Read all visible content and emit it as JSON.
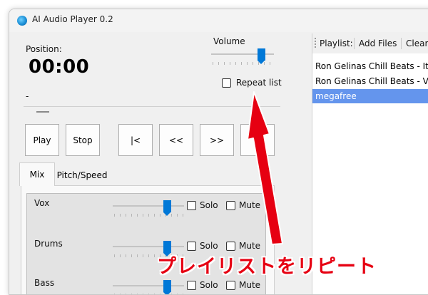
{
  "window": {
    "title": "AI Audio Player 0.2"
  },
  "position": {
    "label": "Position:",
    "value": "00:00",
    "sub_value": "-"
  },
  "volume": {
    "label": "Volume",
    "level_fraction": 0.85
  },
  "repeat": {
    "label": "Repeat list",
    "checked": false
  },
  "transport": {
    "play": "Play",
    "stop": "Stop",
    "prev": "|<",
    "rewind": "<<",
    "forward": ">>",
    "next": ">|"
  },
  "tabs": [
    {
      "label": "Mix",
      "active": true
    },
    {
      "label": "Pitch/Speed",
      "active": false
    }
  ],
  "mix": {
    "solo_label": "Solo",
    "mute_label": "Mute",
    "tracks": [
      {
        "name": "Vox",
        "level_fraction": 0.8
      },
      {
        "name": "Drums",
        "level_fraction": 0.8
      },
      {
        "name": "Bass",
        "level_fraction": 0.8
      }
    ]
  },
  "playlist": {
    "toolbar_label": "Playlist:",
    "add_files": "Add Files",
    "clear": "Clear",
    "items": [
      {
        "text": "Ron Gelinas Chill Beats - It's Jus",
        "selected": false
      },
      {
        "text": "Ron Gelinas Chill Beats - Vibe",
        "selected": false
      },
      {
        "text": "megafree",
        "selected": true
      }
    ]
  },
  "annotation": {
    "caption": "プレイリストをリピート",
    "arrow_color": "#e60012"
  }
}
